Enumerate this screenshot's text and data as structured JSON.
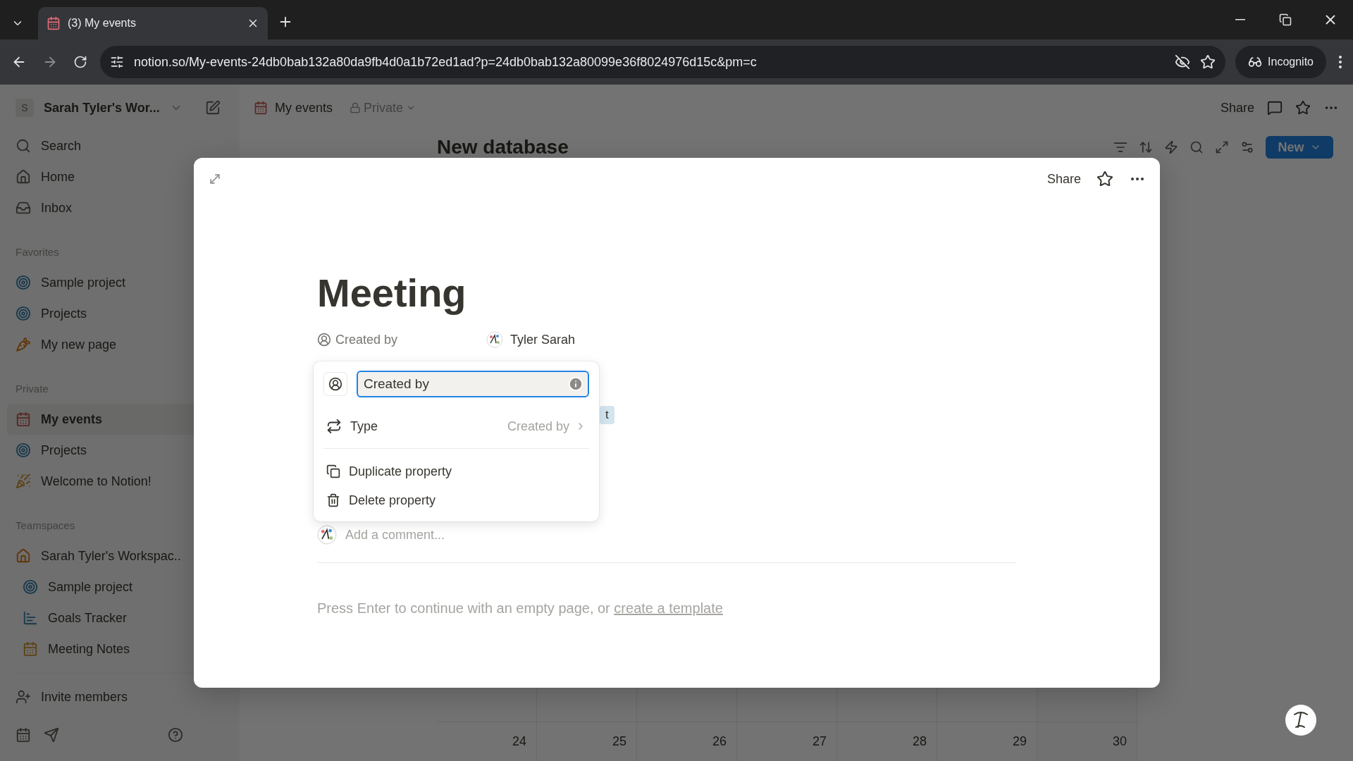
{
  "browser": {
    "tab_title": "(3) My events",
    "url": "notion.so/My-events-24db0bab132a80da9fb4d0a1b72ed1ad?p=24db0bab132a80099e36f8024976d15c&pm=c",
    "incognito_label": "Incognito"
  },
  "sidebar": {
    "workspace_initial": "S",
    "workspace": "Sarah Tyler's Wor...",
    "nav": [
      {
        "label": "Search",
        "kind": "search"
      },
      {
        "label": "Home",
        "kind": "home"
      },
      {
        "label": "Inbox",
        "kind": "inbox"
      }
    ],
    "sections": [
      {
        "heading": "Favorites",
        "items": [
          {
            "label": "Sample project",
            "kind": "target",
            "selected": false
          },
          {
            "label": "Projects",
            "kind": "target",
            "selected": false
          },
          {
            "label": "My new page",
            "kind": "carrot",
            "selected": false
          }
        ]
      },
      {
        "heading": "Private",
        "items": [
          {
            "label": "My events",
            "kind": "calendar",
            "selected": true
          },
          {
            "label": "Projects",
            "kind": "target",
            "selected": false
          },
          {
            "label": "Welcome to Notion!",
            "kind": "party",
            "selected": false
          }
        ]
      },
      {
        "heading": "Teamspaces",
        "items": [
          {
            "label": "Sarah Tyler's Workspac..",
            "kind": "house",
            "selected": false,
            "children": [
              {
                "label": "Sample project",
                "kind": "target",
                "selected": false
              },
              {
                "label": "Goals Tracker",
                "kind": "chart",
                "selected": false
              },
              {
                "label": "Meeting Notes",
                "kind": "notes",
                "selected": false
              }
            ]
          }
        ]
      }
    ],
    "invite": "Invite members"
  },
  "topbar": {
    "breadcrumb": "My events",
    "privacy": "Private",
    "share": "Share"
  },
  "database": {
    "title": "New database",
    "new_button": "New",
    "calendar_days": [
      "24",
      "25",
      "26",
      "27",
      "28",
      "29",
      "30"
    ]
  },
  "modal": {
    "share": "Share",
    "title": "Meeting",
    "property": {
      "name": "Created by",
      "value": "Tyler Sarah"
    },
    "partial_tag": "t",
    "popup": {
      "name_value": "Created by",
      "type_label": "Type",
      "type_value": "Created by",
      "actions": [
        {
          "label": "Duplicate property",
          "kind": "duplicate"
        },
        {
          "label": "Delete property",
          "kind": "delete"
        }
      ]
    },
    "comment_placeholder": "Add a comment...",
    "hint": "Press Enter to continue with an empty page, or ",
    "hint_link": "create a template"
  }
}
